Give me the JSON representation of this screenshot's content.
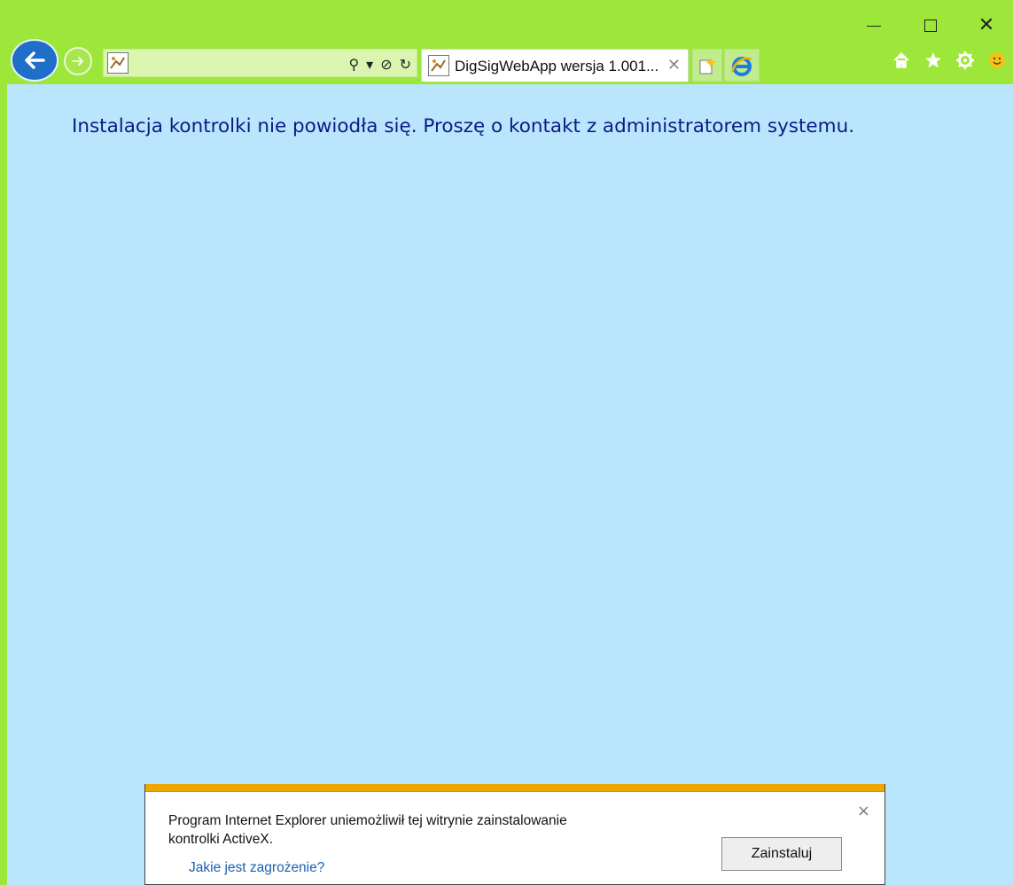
{
  "window": {
    "minimize_icon": "minimize-icon",
    "maximize_icon": "maximize-icon",
    "close_icon": "close-icon",
    "close_glyph": "✕"
  },
  "toolbar": {
    "address_value": "",
    "address_tools": {
      "search_glyph": "⚲",
      "dropdown_glyph": "▾",
      "stop_glyph": "⊘",
      "refresh_glyph": "↻"
    }
  },
  "tab": {
    "title": "DigSigWebApp wersja 1.001...",
    "close_glyph": "✕"
  },
  "colors": {
    "chrome": "#9de73a",
    "content_bg": "#bae6fd",
    "message_text": "#0b1b86",
    "notification_stripe": "#f0a600"
  },
  "content": {
    "message": "Instalacja kontrolki nie powiodła się. Proszę o kontakt z administratorem systemu."
  },
  "notification": {
    "text_line1": "Program Internet Explorer uniemożliwił tej witrynie zainstalowanie",
    "text_line2": "kontrolki ActiveX.",
    "link": "Jakie jest zagrożenie?",
    "install_button": "Zainstaluj",
    "close_glyph": "×"
  }
}
